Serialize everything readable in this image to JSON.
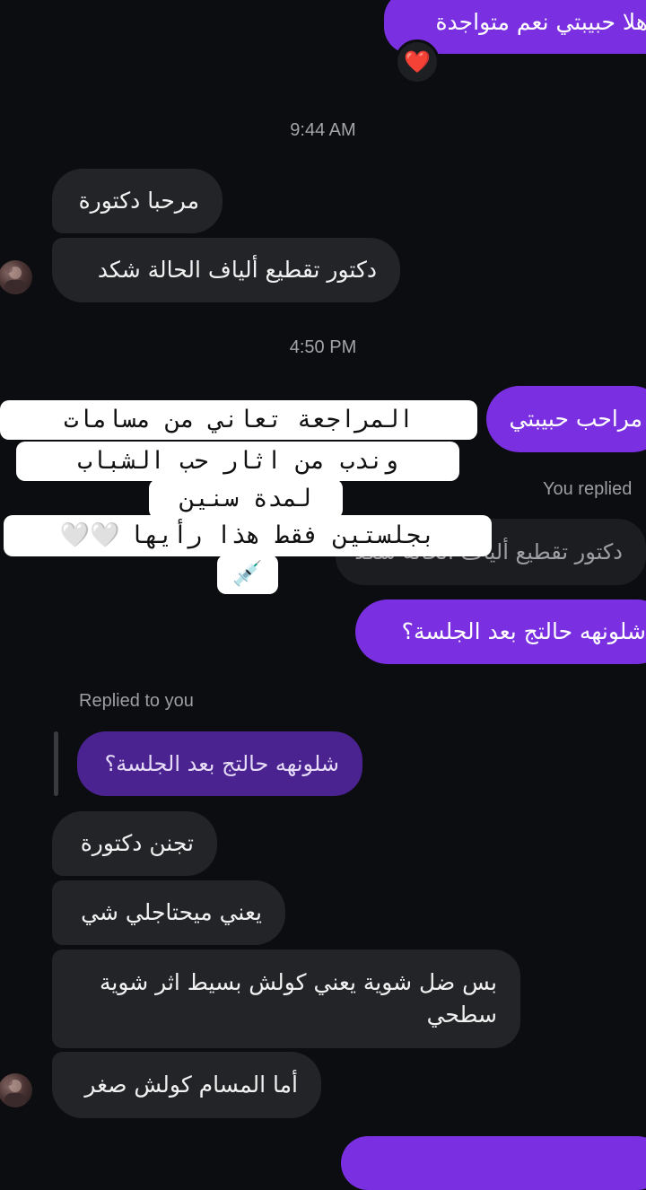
{
  "messages": {
    "top_outgoing": "هلا حبيبتي نعم متواجدة",
    "reaction_heart": "❤️",
    "time_1": "9:44 AM",
    "incoming_1": "مرحبا دكتورة",
    "incoming_2": "دكتور تقطيع ألياف الحالة شكد",
    "time_2": "4:50 PM",
    "outgoing_welcome": "مراحب حبيبتي",
    "you_replied_label": "You replied",
    "quoted_incoming": "دكتور تقطيع ألياف الحالة شكد",
    "outgoing_question": "شلونهه حالتج بعد الجلسة؟",
    "replied_to_you_label": "Replied to you",
    "quoted_outgoing": "شلونهه حالتج بعد الجلسة؟",
    "incoming_3": "تجنن دكتورة",
    "incoming_4": "يعني ميحتاجلي شي",
    "incoming_5_line1": "بس ضل شوية يعني كولش بسيط اثر شوية",
    "incoming_5_line2": "سطحي",
    "incoming_6": "أما المسام كولش صغر"
  },
  "overlay": {
    "line1": "المراجعة تعاني من مسامات",
    "line2": "وندب من اثار حب الشباب",
    "line3": "لمدة سنين",
    "line4_text": "بجلستين فقط هذا رأيها",
    "line4_emoji": "🤍🤍",
    "line5_emoji": "💉"
  },
  "colors": {
    "background": "#0c0d10",
    "outgoing_bubble": "#7a2fe0",
    "incoming_bubble": "#232428",
    "quoted_outgoing_bubble": "#4a2390"
  },
  "icons": {
    "avatar": "user-avatar",
    "heart": "red-heart-icon",
    "syringe": "syringe-icon"
  }
}
